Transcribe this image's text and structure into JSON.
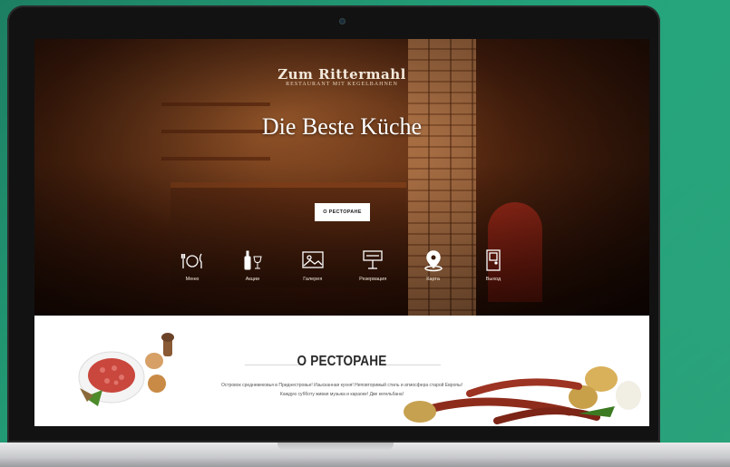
{
  "hero": {
    "logo_name": "Zum Rittermahl",
    "logo_sub": "RESTAURANT MIT KEGELBAHNEN",
    "title": "Die Beste Küche",
    "cta_label": "О РЕСТОРАНЕ"
  },
  "nav": [
    {
      "label": "Меню",
      "icon": "cutlery-icon"
    },
    {
      "label": "Акции",
      "icon": "wine-icon"
    },
    {
      "label": "Галерея",
      "icon": "image-icon"
    },
    {
      "label": "Резервация",
      "icon": "reservation-sign-icon"
    },
    {
      "label": "Карта",
      "icon": "map-pin-icon"
    },
    {
      "label": "Выход",
      "icon": "door-icon"
    }
  ],
  "about": {
    "title": "О РЕСТОРАНЕ",
    "text_line1": "Островок средневековья в Приднестровье! Изысканная кухня! Неповторимый стиль и атмосфера старой Европы!",
    "text_line2": "Каждую субботу живая музыка и караоке! Две кегельбана!"
  },
  "colors": {
    "background": "#23a078",
    "hero_dark": "#2a0f06",
    "accent_warm": "#c4783c"
  }
}
